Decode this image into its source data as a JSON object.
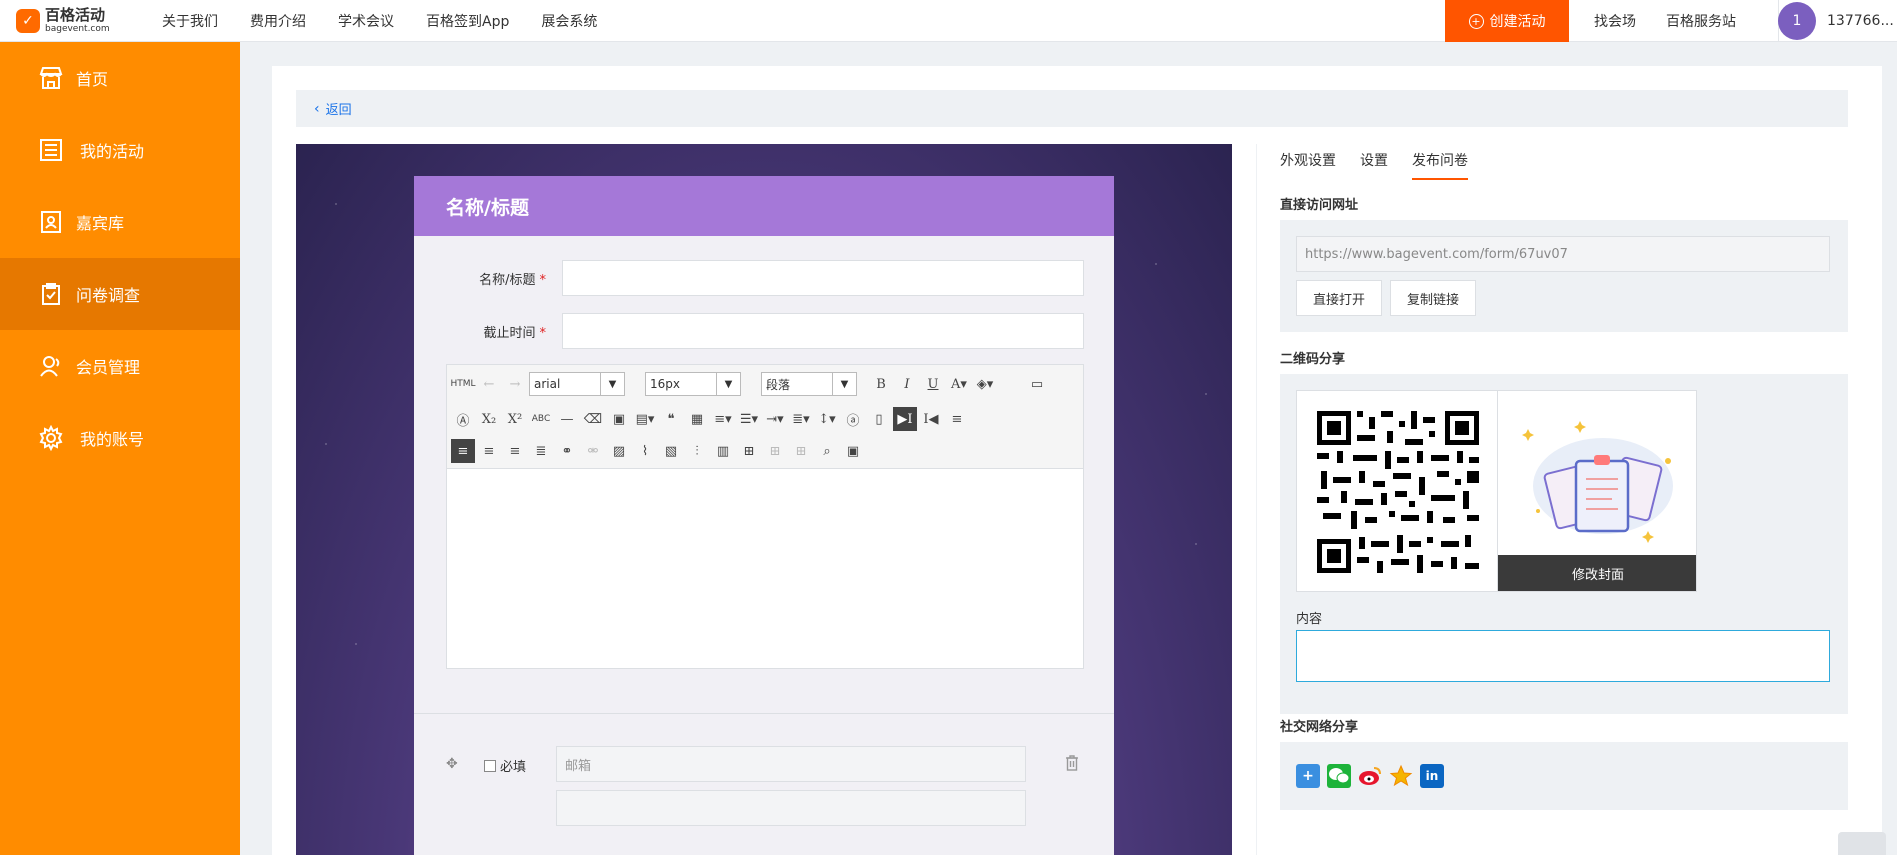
{
  "brand": {
    "name_cn": "百格活动",
    "name_en": "bagevent.com",
    "logo_glyph": "✓"
  },
  "top_nav": [
    "关于我们",
    "费用介绍",
    "学术会议",
    "百格签到App",
    "展会系统"
  ],
  "create_button": "创建活动",
  "right_links": [
    "找会场",
    "百格服务站"
  ],
  "user": {
    "avatar_text": "1",
    "name": "137766..."
  },
  "sidebar": {
    "items": [
      {
        "label": "首页",
        "icon": "store-icon"
      },
      {
        "label": "我的活动",
        "icon": "list-icon"
      },
      {
        "label": "嘉宾库",
        "icon": "guest-card-icon"
      },
      {
        "label": "问卷调查",
        "icon": "clipboard-check-icon",
        "active": true
      },
      {
        "label": "会员管理",
        "icon": "member-icon"
      },
      {
        "label": "我的账号",
        "icon": "gear-icon"
      }
    ]
  },
  "back_label": "返回",
  "form": {
    "header_title": "名称/标题",
    "fields": [
      {
        "label": "名称/标题",
        "required": "*"
      },
      {
        "label": "截止时间",
        "required": "*"
      }
    ],
    "editor": {
      "font_family": "arial",
      "font_size": "16px",
      "paragraph": "段落",
      "html_label": "HTML"
    },
    "question": {
      "required_label": "必填",
      "placeholder": "邮箱"
    }
  },
  "settings": {
    "tabs": [
      "外观设置",
      "设置",
      "发布问卷"
    ],
    "active_tab": 2,
    "direct_url_title": "直接访问网址",
    "url": "https://www.bagevent.com/form/67uv07",
    "open_button": "直接打开",
    "copy_button": "复制链接",
    "qr_title": "二维码分享",
    "cover_button": "修改封面",
    "content_label": "内容",
    "social_title": "社交网络分享"
  },
  "colors": {
    "accent": "#ff5500",
    "sidebar": "#ff8c00",
    "sidebar_active": "#e67800",
    "form_header": "#a578d8",
    "link": "#1a73e8"
  }
}
